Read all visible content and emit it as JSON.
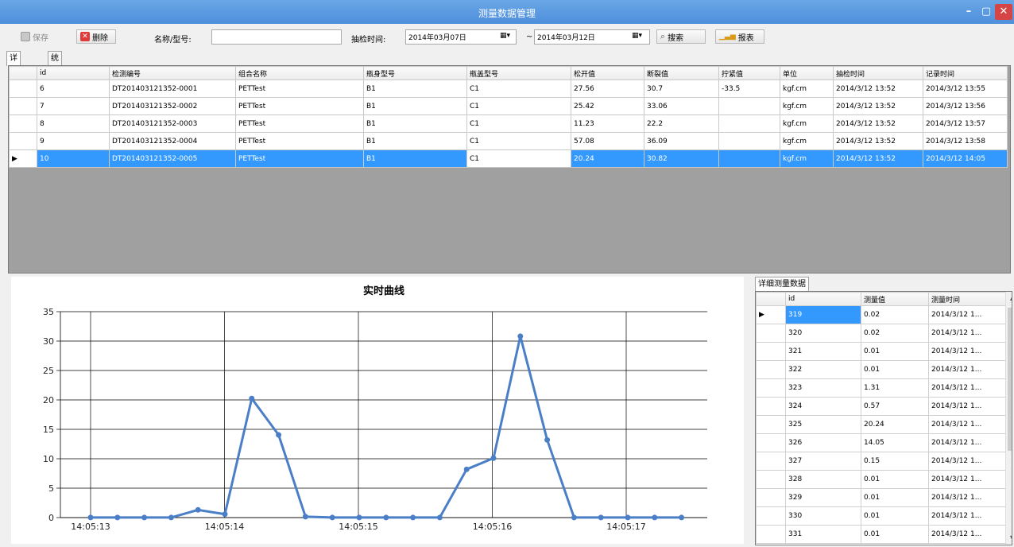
{
  "window": {
    "title": "测量数据管理"
  },
  "toolbar": {
    "save_label": "保存",
    "delete_label": "删除",
    "name_label": "名称/型号:",
    "name_value": "",
    "time_label": "抽检时间:",
    "date_from": "2014年03月07日",
    "date_sep": "~",
    "date_to": "2014年03月12日",
    "search_label": "搜索",
    "report_label": "报表"
  },
  "tabs": [
    {
      "label": "详细列表"
    },
    {
      "label": "统计报表"
    }
  ],
  "grid": {
    "headers": [
      "id",
      "检测编号",
      "组合名称",
      "瓶身型号",
      "瓶盖型号",
      "松开值",
      "断裂值",
      "拧紧值",
      "单位",
      "抽检时间",
      "记录时间"
    ],
    "rows": [
      [
        "6",
        "DT201403121352-0001",
        "PETTest",
        "B1",
        "C1",
        "27.56",
        "30.7",
        "-33.5",
        "kgf.cm",
        "2014/3/12 13:52",
        "2014/3/12 13:55"
      ],
      [
        "7",
        "DT201403121352-0002",
        "PETTest",
        "B1",
        "C1",
        "25.42",
        "33.06",
        "",
        "kgf.cm",
        "2014/3/12 13:52",
        "2014/3/12 13:56"
      ],
      [
        "8",
        "DT201403121352-0003",
        "PETTest",
        "B1",
        "C1",
        "11.23",
        "22.2",
        "",
        "kgf.cm",
        "2014/3/12 13:52",
        "2014/3/12 13:57"
      ],
      [
        "9",
        "DT201403121352-0004",
        "PETTest",
        "B1",
        "C1",
        "57.08",
        "36.09",
        "",
        "kgf.cm",
        "2014/3/12 13:52",
        "2014/3/12 13:58"
      ],
      [
        "10",
        "DT201403121352-0005",
        "PETTest",
        "B1",
        "C1",
        "20.24",
        "30.82",
        "",
        "kgf.cm",
        "2014/3/12 13:52",
        "2014/3/12 14:05"
      ]
    ],
    "selected_row": 4
  },
  "detail": {
    "tab_label": "详细测量数据",
    "headers": [
      "id",
      "测量值",
      "测量时间"
    ],
    "rows": [
      [
        "319",
        "0.02",
        "2014/3/12 1..."
      ],
      [
        "320",
        "0.02",
        "2014/3/12 1..."
      ],
      [
        "321",
        "0.01",
        "2014/3/12 1..."
      ],
      [
        "322",
        "0.01",
        "2014/3/12 1..."
      ],
      [
        "323",
        "1.31",
        "2014/3/12 1..."
      ],
      [
        "324",
        "0.57",
        "2014/3/12 1..."
      ],
      [
        "325",
        "20.24",
        "2014/3/12 1..."
      ],
      [
        "326",
        "14.05",
        "2014/3/12 1..."
      ],
      [
        "327",
        "0.15",
        "2014/3/12 1..."
      ],
      [
        "328",
        "0.01",
        "2014/3/12 1..."
      ],
      [
        "329",
        "0.01",
        "2014/3/12 1..."
      ],
      [
        "330",
        "0.01",
        "2014/3/12 1..."
      ],
      [
        "331",
        "0.01",
        "2014/3/12 1..."
      ]
    ]
  },
  "chart_data": {
    "type": "line",
    "title": "实时曲线",
    "xlabel": "",
    "ylabel": "",
    "x_tick_labels": [
      "14:05:13",
      "14:05:14",
      "14:05:15",
      "14:05:16",
      "14:05:17"
    ],
    "y_ticks": [
      0,
      5,
      10,
      15,
      20,
      25,
      30,
      35
    ],
    "ylim": [
      0,
      35
    ],
    "grid": true,
    "color": "#4a7ec6",
    "series": [
      {
        "values": [
          0.02,
          0.02,
          0.01,
          0.01,
          1.31,
          0.57,
          20.24,
          14.05,
          0.15,
          0.01,
          0.01,
          0.01,
          0.01,
          0.01,
          8.2,
          10.1,
          30.82,
          13.2,
          0.01,
          0.01,
          0.01,
          0.01,
          0.01
        ]
      }
    ]
  }
}
